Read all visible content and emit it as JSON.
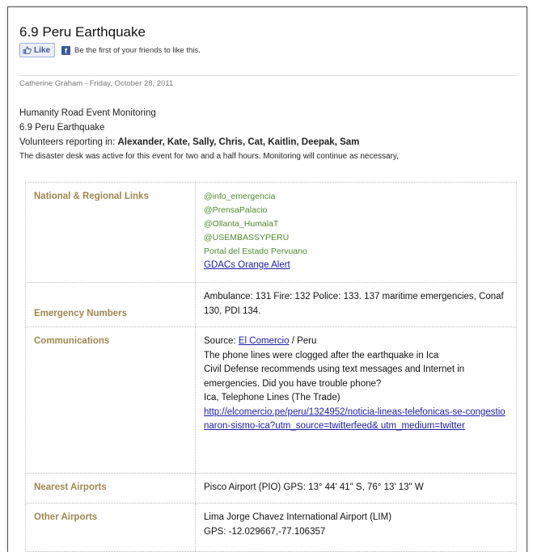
{
  "post": {
    "title": "6.9 Peru Earthquake",
    "like_label": "Like",
    "like_text": "Be the first of your friends to like this.",
    "byline": "Catherine Graham - Friday, October 28, 2011"
  },
  "intro": {
    "line1": "Humanity Road Event Monitoring",
    "line2": "6.9 Peru Earthquake",
    "volunteers_prefix": "Volunteers reporting in:",
    "volunteers_names": "Alexander, Kate, Sally, Chris, Cat, Kaitlin, Deepak, Sam",
    "note": "The disaster desk was active for this event for two and a half hours.  Monitoring will continue as necessary,"
  },
  "table": {
    "rows": [
      {
        "label": "National &  Regional Links",
        "links": [
          "@info_emergencia",
          "@PrensaPalacio",
          "@Ollanta_HumalaT",
          "@USEMBASSYPERU",
          "Portal del Estado Pervuano"
        ],
        "alert": "GDACs Orange Alert"
      },
      {
        "label": "Emergency Numbers",
        "text": "Ambulance: 131 Fire: 132 Police: 133. 137 maritime emergencies, Conaf 130, PDI 134."
      },
      {
        "label": "Communications",
        "source_prefix": "Source:",
        "source_link": "El Comercio",
        "source_suffix": "  / Peru",
        "line1": "The phone lines were clogged after the earthquake in Ica",
        "line2": "Civil Defense recommends using text messages and Internet in emergencies. Did you have trouble phone?",
        "line3": "Ica, Telephone Lines (The Trade)",
        "url": "http://elcomercio.pe/peru/1324952/noticia-lineas-telefonicas-se-congestionaron-sismo-ica?utm_source=twitterfeed& utm_medium=twitter"
      },
      {
        "label": "Nearest Airports",
        "text": "Pisco Airport (PIO) GPS: 13° 44' 41\" S, 76° 13' 13\" W"
      },
      {
        "label": "Other Airports",
        "line1": "Lima Jorge Chavez International Airport (LIM)",
        "line2": "GPS: -12.029667,-77.106357"
      }
    ]
  }
}
